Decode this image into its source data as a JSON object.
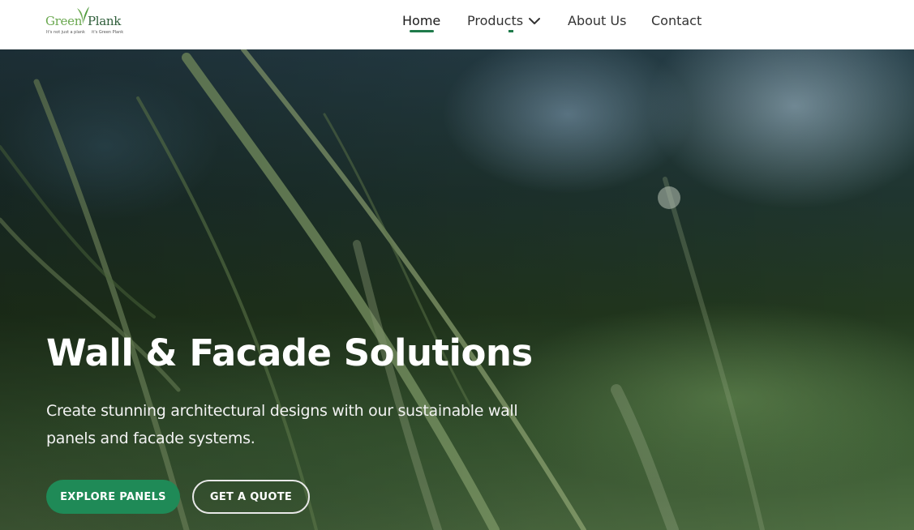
{
  "brand": {
    "word1": "Green",
    "word2": "Plank",
    "tagline1": "It's not just a plank",
    "tagline2": "it's Green Plank",
    "color_green": "#6aa84f",
    "color_dark": "#2f5e3a"
  },
  "nav": {
    "items": [
      {
        "label": "Home",
        "active": true
      },
      {
        "label": "Products",
        "has_dropdown": true,
        "icon": "chevron-down-icon"
      },
      {
        "label": "About Us"
      },
      {
        "label": "Contact"
      }
    ],
    "accent": "#1f7a4a"
  },
  "hero": {
    "title": "Wall & Facade Solutions",
    "subtitle": "Create stunning architectural designs with our sustainable wall panels and facade systems.",
    "buttons": {
      "primary": "EXPLORE PANELS",
      "secondary": "GET A QUOTE"
    },
    "primary_color": "#1f8a57"
  }
}
